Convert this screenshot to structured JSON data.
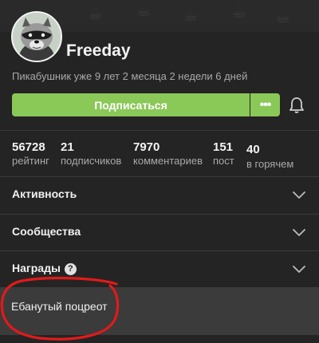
{
  "profile": {
    "username": "Freeday",
    "tenure": "Пикабушник уже 9 лет 2 месяца 2 недели 6 дней",
    "avatar_icon": "raccoon-avatar-icon"
  },
  "actions": {
    "subscribe_label": "Подписаться",
    "more_label": "•••",
    "more_icon": "more-dots-icon",
    "bell_icon": "bell-icon",
    "accent_color": "#8ac858"
  },
  "stats": [
    {
      "value": "56728",
      "label": "рейтинг"
    },
    {
      "value": "21",
      "label": "подписчиков"
    },
    {
      "value": "7970",
      "label": "комментариев"
    },
    {
      "value": "151",
      "label": "пост"
    },
    {
      "value": "40",
      "label": "в горячем"
    }
  ],
  "sections": [
    {
      "label": "Активность",
      "icon": "chevron-down-icon"
    },
    {
      "label": "Сообщества",
      "icon": "chevron-down-icon"
    },
    {
      "label": "Награды",
      "help_icon": "help-icon",
      "help_text": "?",
      "icon": "chevron-down-icon"
    }
  ],
  "badge": {
    "text": "Ебанутый поцреот",
    "annotation_color": "#e11a1a"
  }
}
